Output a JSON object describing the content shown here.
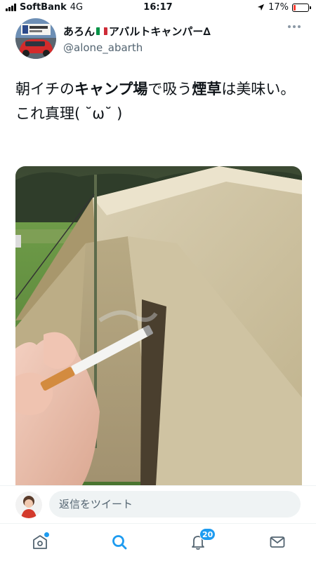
{
  "status_bar": {
    "carrier": "SoftBank",
    "network": "4G",
    "time": "16:17",
    "battery_percent": "17%",
    "battery_level": 0.17,
    "battery_color": "#ff3b30"
  },
  "tweet": {
    "author": {
      "display_name": "あろん",
      "display_name_suffix": "アバルトキャンパー∆",
      "handle": "@alone_abarth"
    },
    "text": {
      "line1_p1": "朝イチの",
      "line1_b1": "キャンプ場",
      "line1_p2": "で吸う",
      "line1_b2": "煙草",
      "line1_p3": "は美味い。",
      "line2": "これ真理( ˘ω˘ )"
    }
  },
  "reply": {
    "placeholder": "返信をツイート"
  },
  "tab_bar": {
    "notifications_count": "20",
    "accent": "#1d9bf0"
  },
  "icons": {
    "home": "home-icon",
    "search": "search-icon",
    "notifications": "bell-icon",
    "messages": "mail-icon",
    "more": "more-icon",
    "location": "location-arrow-icon"
  }
}
